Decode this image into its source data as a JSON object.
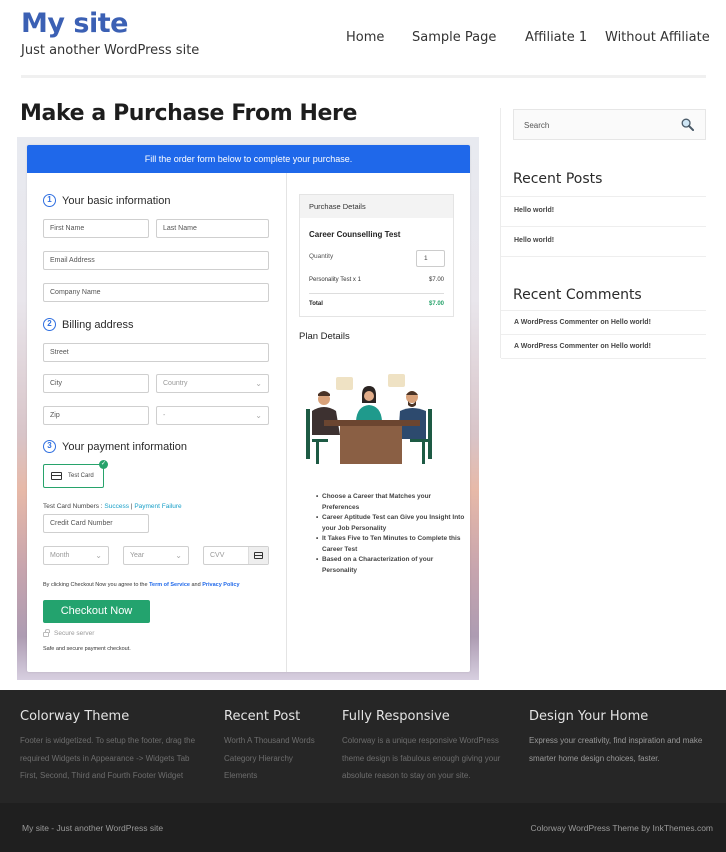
{
  "header": {
    "site_title": "My site",
    "tagline": "Just another WordPress site",
    "nav": [
      {
        "label": "Home"
      },
      {
        "label": "Sample Page"
      },
      {
        "label": "Affiliate 1"
      },
      {
        "label": "Without Affiliate"
      }
    ]
  },
  "main": {
    "page_title": "Make a Purchase From Here",
    "form": {
      "banner": "Fill the order form below to complete your purchase.",
      "sections": [
        {
          "number": "1",
          "label": "Your basic information"
        },
        {
          "number": "2",
          "label": "Billing address"
        },
        {
          "number": "3",
          "label": "Your payment information"
        }
      ],
      "fields": {
        "first_name": "First Name",
        "last_name": "Last Name",
        "email": "Email Address",
        "company": "Company Name",
        "street": "Street",
        "city": "City",
        "country": "Country",
        "zip": "Zip",
        "state": "-",
        "card_number": "Credit Card Number",
        "month": "Month",
        "year": "Year",
        "cvv": "CVV"
      },
      "payment_method": {
        "label": "Test Card",
        "selected": true
      },
      "test_numbers": {
        "prefix": "Test Card Numbers : ",
        "success": "Success",
        "separator": " | ",
        "failure": "Payment Failure"
      },
      "agreement": {
        "prefix": "By clicking Checkout Now you agree to the ",
        "terms": "Term of Service",
        "and": " and ",
        "privacy": "Privacy Policy"
      },
      "checkout_label": "Checkout Now",
      "secure_label": "Secure server",
      "safe_label": "Safe and secure payment checkout."
    },
    "purchase_details": {
      "header": "Purchase Details",
      "product": "Career Counselling Test",
      "quantity_label": "Quantity",
      "quantity": "1",
      "line_item": "Personality Test x 1",
      "line_amount": "$7.00",
      "total_label": "Total",
      "total_amount": "$7.00"
    },
    "plan": {
      "title": "Plan Details",
      "image_alt": "meeting-illustration",
      "items": [
        "Choose a Career that Matches your Preferences",
        "Career Aptitude Test can Give you Insight Into your Job Personality",
        "It Takes Five to Ten Minutes to Complete this Career Test",
        "Based on a Characterization of your Personality"
      ]
    }
  },
  "sidebar": {
    "search_placeholder": "Search",
    "recent_posts_title": "Recent Posts",
    "recent_posts": [
      "Hello world!",
      "Hello world!"
    ],
    "recent_comments_title": "Recent Comments",
    "recent_comments": [
      "A WordPress Commenter on Hello world!",
      "A WordPress Commenter on Hello world!"
    ]
  },
  "footer": {
    "columns": [
      {
        "title": "Colorway Theme",
        "lines": [
          "Footer is widgetized. To setup the footer, drag the",
          "required Widgets in Appearance -> Widgets Tab",
          "First, Second, Third and Fourth Footer Widget"
        ]
      },
      {
        "title": "Recent Post",
        "lines": [
          "Worth A Thousand Words",
          "Category Hierarchy",
          "Elements"
        ]
      },
      {
        "title": "Fully Responsive",
        "lines": [
          "Colorway is a unique responsive WordPress",
          "theme design is fabulous enough giving your",
          "absolute reason to stay on your site."
        ]
      },
      {
        "title": "Design Your Home",
        "lines": [
          "Express your creativity, find inspiration and make",
          "smarter home design choices, faster."
        ]
      }
    ],
    "bottom_left": "My site - Just another WordPress site",
    "bottom_right": "Colorway WordPress Theme by InkThemes.com"
  },
  "colors": {
    "brand_blue": "#3b60b4",
    "banner_blue": "#1f68ea",
    "checkout_green": "#23a36e",
    "total_green": "#27a36b",
    "footer_bg": "#262626"
  }
}
